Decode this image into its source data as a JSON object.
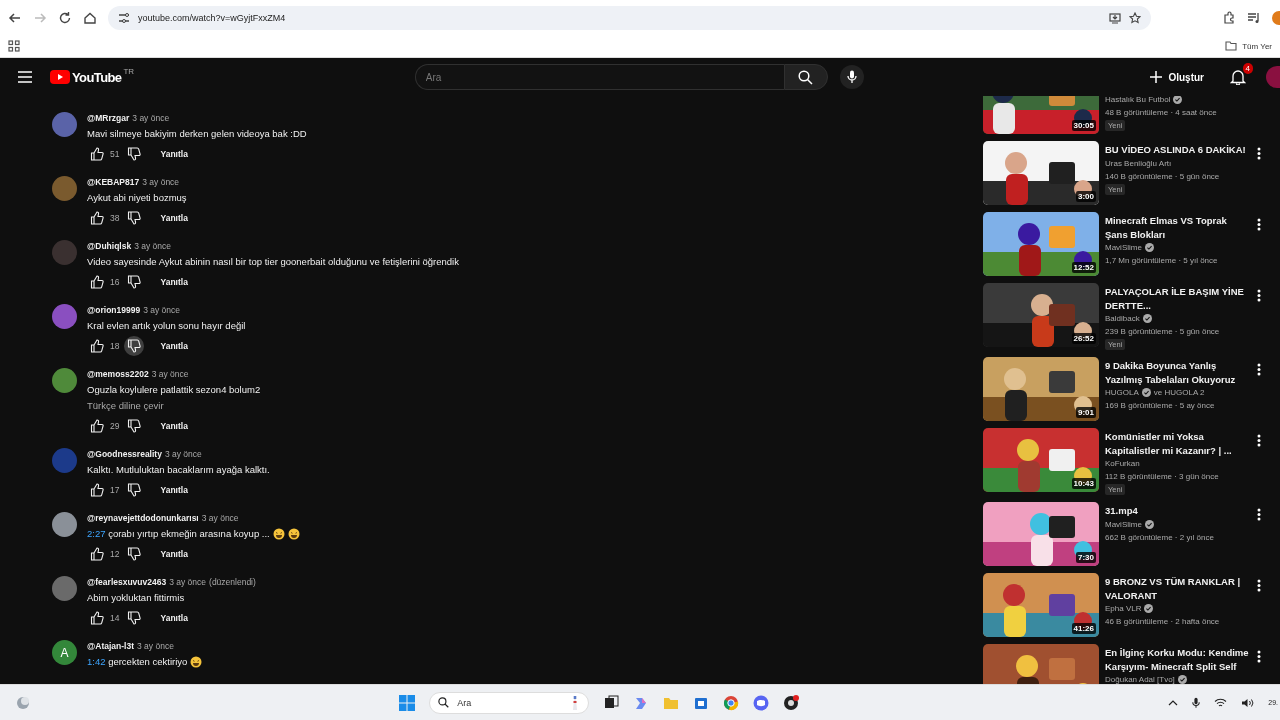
{
  "browser": {
    "url": "youtube.com/watch?v=wGyjtFxxZM4",
    "forward_disabled": true,
    "bookmark_folder": "Tüm Yer"
  },
  "header": {
    "logo": "YouTube",
    "region": "TR",
    "search_placeholder": "Ara",
    "create_label": "Oluştur",
    "notification_count": "4"
  },
  "comments": [
    {
      "author": "@MRrzgar",
      "time": "3 ay önce",
      "text": "Mavi silmeye bakiyim derken gelen videoya bak :DD",
      "likes": "51",
      "reply": "Yanıtla",
      "dislike_hovered": false,
      "avatar": {
        "color": "#5a63a8"
      }
    },
    {
      "author": "@KEBAP817",
      "time": "3 ay önce",
      "text": "Aykut abi niyeti bozmuş",
      "likes": "38",
      "reply": "Yanıtla",
      "dislike_hovered": false,
      "avatar": {
        "color": "#7a5a2e"
      }
    },
    {
      "author": "@Duhiqlsk",
      "time": "3 ay önce",
      "text": "Video sayesinde Aykut abinin nasıl bir top tier goonerbait olduğunu ve fetişlerini öğrendik",
      "likes": "16",
      "reply": "Yanıtla",
      "dislike_hovered": false,
      "avatar": {
        "color": "#3a3030"
      }
    },
    {
      "author": "@orion19999",
      "time": "3 ay önce",
      "text": "Kral evlen artık yolun sonu hayır değil",
      "likes": "18",
      "reply": "Yanıtla",
      "dislike_hovered": true,
      "avatar": {
        "color": "#8a4fc0"
      }
    },
    {
      "author": "@memoss2202",
      "time": "3 ay önce",
      "text": "Oguzla koylulere patlattik sezon4 bolum2",
      "translate": "Türkçe diline çevir",
      "likes": "29",
      "reply": "Yanıtla",
      "dislike_hovered": false,
      "avatar": {
        "color": "#4f8a3a"
      }
    },
    {
      "author": "@Goodnessreality",
      "time": "3 ay önce",
      "text": "Kalktı. Mutluluktan bacaklarım ayağa kalktı.",
      "likes": "17",
      "reply": "Yanıtla",
      "dislike_hovered": false,
      "avatar": {
        "color": "#1c3a8a"
      }
    },
    {
      "author": "@reynavejettdodonunkarısı",
      "time": "3 ay önce",
      "timestamp": "2:27",
      "text": "çorabı yırtıp ekmeğin arasına koyup ...",
      "trailing_emoji": [
        {
          "kind": "laugh"
        },
        {
          "kind": "laugh"
        }
      ],
      "likes": "12",
      "reply": "Yanıtla",
      "dislike_hovered": false,
      "avatar": {
        "color": "#8a9098"
      }
    },
    {
      "author": "@fearlesxuvuv2463",
      "time": "3 ay önce",
      "edited": "(düzenlendi)",
      "text": "Abim yokluktan fittirmis",
      "likes": "14",
      "reply": "Yanıtla",
      "dislike_hovered": false,
      "avatar": {
        "color": "#6a6a6a"
      }
    },
    {
      "author": "@Atajan-l3t",
      "time": "3 ay önce",
      "timestamp": "1:42",
      "text": "gercekten cektiriyo",
      "trailing_emoji": [
        {
          "kind": "laugh"
        }
      ],
      "avatar": {
        "color": "#33873a",
        "letter": "A"
      }
    }
  ],
  "sidebar": [
    {
      "kind": "partial",
      "channel": "Hastalık Bu Futbol",
      "verified": true,
      "views": "48 B görüntüleme · 4 saat önce",
      "badge": "Yeni",
      "duration": "30:05"
    },
    {
      "kind": "video",
      "title": "BU VİDEO ASLINDA 6 DAKİKA!",
      "channel": "Uras Benlioğlu Artı",
      "verified": false,
      "views": "140 B görüntüleme · 5 gün önce",
      "badge": "Yeni",
      "duration": "3:00"
    },
    {
      "kind": "video",
      "title": "Minecraft Elmas VS Toprak Şans Blokları",
      "channel": "MaviSlime",
      "verified": true,
      "views": "1,7 Mn görüntüleme · 5 yıl önce",
      "duration": "12:52"
    },
    {
      "kind": "video",
      "title": "PALYAÇOLAR İLE BAŞIM YİNE DERTTE...",
      "channel": "Baldiback",
      "verified": true,
      "views": "239 B görüntüleme · 5 gün önce",
      "badge": "Yeni",
      "duration": "26:52"
    },
    {
      "kind": "video",
      "title": "9 Dakika Boyunca Yanlış Yazılmış Tabelaları Okuyoruz",
      "channel": "HUGOLA",
      "verified": true,
      "channel_extra": "ve HUGOLA 2",
      "views": "169 B görüntüleme · 5 ay önce",
      "duration": "9:01"
    },
    {
      "kind": "video",
      "title": "Komünistler mi Yoksa Kapitalistler mi Kazanır? | ...",
      "channel": "KoFurkan",
      "verified": false,
      "views": "112 B görüntüleme · 3 gün önce",
      "badge": "Yeni",
      "duration": "10:43"
    },
    {
      "kind": "video",
      "title": "31.mp4",
      "channel": "MaviSlime",
      "verified": true,
      "views": "662 B görüntüleme · 2 yıl önce",
      "duration": "7:30"
    },
    {
      "kind": "video",
      "title": "9 BRONZ VS TÜM RANKLAR | VALORANT",
      "channel": "Epha VLR",
      "verified": true,
      "views": "46 B görüntüleme · 2 hafta önce",
      "duration": "41:26"
    },
    {
      "kind": "video",
      "title": "En İlginç Korku Modu: Kendime Karşıyım- Minecraft Split Self",
      "channel": "Doğukan Adal [Tvo]",
      "verified": true
    }
  ],
  "taskbar": {
    "search_placeholder": "Ara",
    "clock": "29."
  }
}
